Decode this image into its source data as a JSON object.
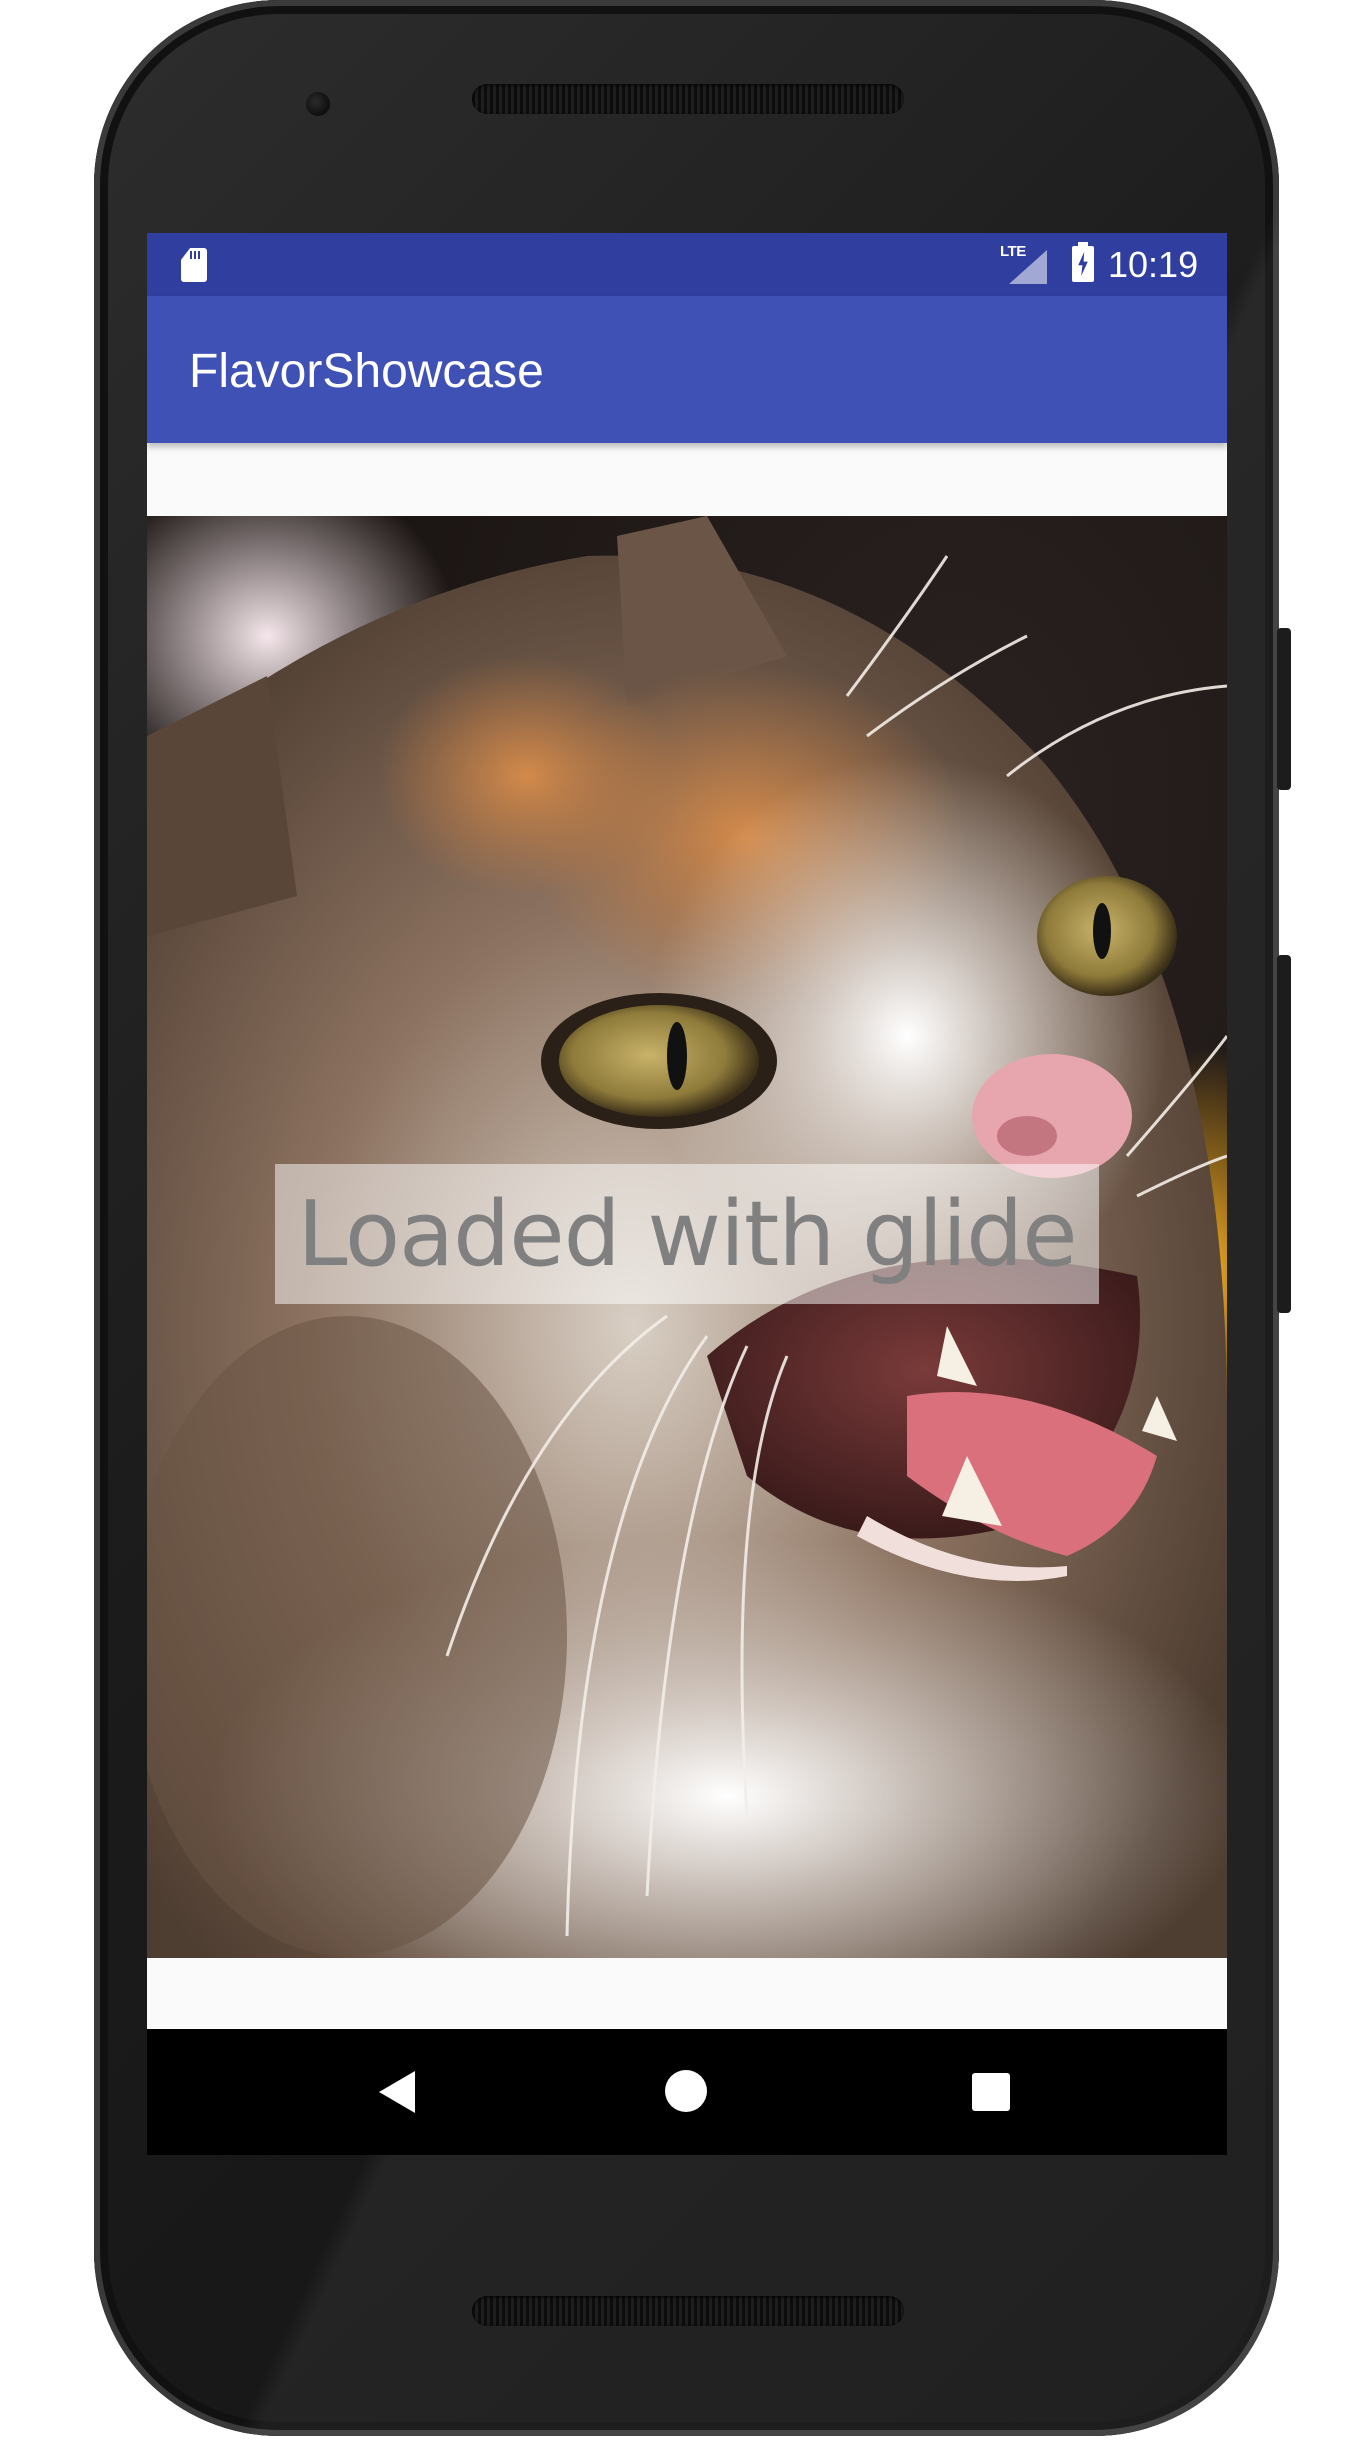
{
  "status_bar": {
    "network_type": "LTE",
    "time": "10:19",
    "icons": [
      "sd-card-icon",
      "signal-icon",
      "battery-charging-icon"
    ]
  },
  "app_bar": {
    "title": "FlavorShowcase"
  },
  "content": {
    "image_description_icon": "cat-photo",
    "overlay_text": "Loaded with glide"
  },
  "nav_bar": {
    "icons": [
      "back-icon",
      "home-icon",
      "recent-apps-icon"
    ]
  },
  "colors": {
    "status_bar": "#303f9f",
    "app_bar": "#3f51b5",
    "background": "#fafafa",
    "overlay_text": "#808080"
  }
}
